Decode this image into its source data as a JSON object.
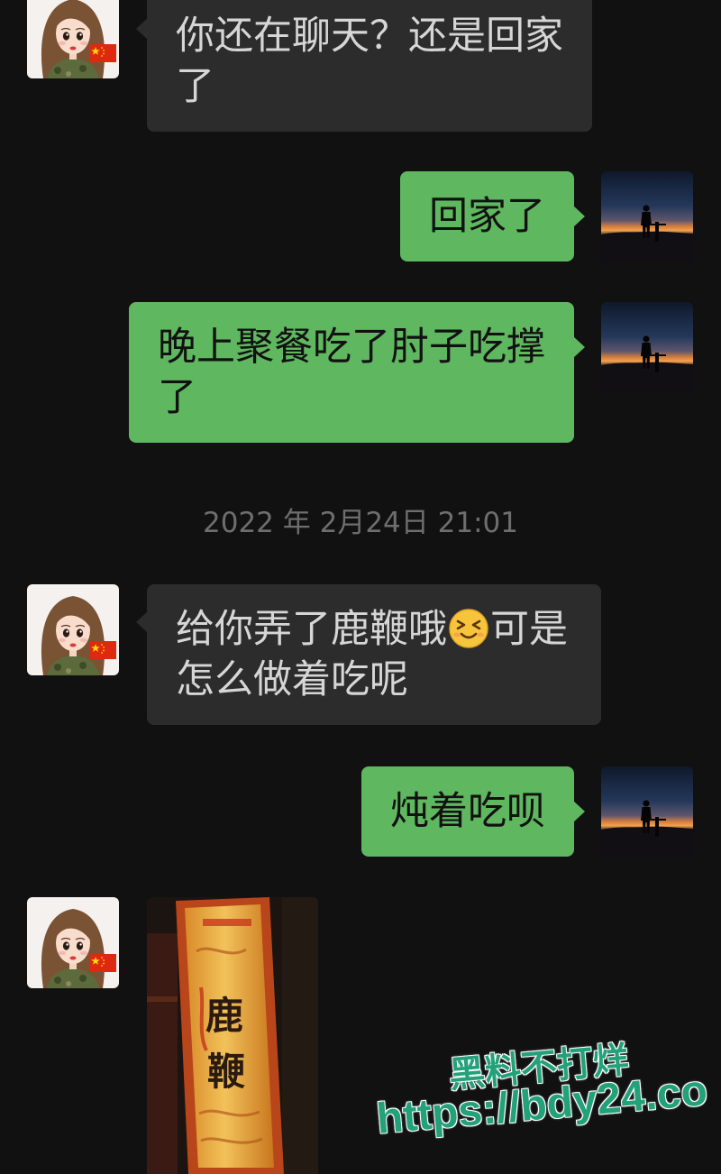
{
  "theme": {
    "background": "#111111",
    "incoming_bubble": "#2c2c2c",
    "incoming_text": "#d6d6d6",
    "outgoing_bubble": "#5fb760",
    "outgoing_text": "#111111",
    "timestamp_text": "#6e6e6e",
    "watermark_text": "#23a178"
  },
  "avatars": {
    "incoming": "girl-cartoon-avatar-icon",
    "outgoing": "sunset-silhouette-avatar-icon"
  },
  "messages": [
    {
      "text": "你还在聊天？还是回家了"
    },
    {
      "text": "回家了"
    },
    {
      "text": "晚上聚餐吃了肘子吃撑了"
    },
    {
      "text_before_emoji": "给你弄了鹿鞭哦",
      "emoji": "grinning-squinting-face-emoji",
      "text_after_emoji": "可是怎么做着吃呢"
    },
    {
      "text": "炖着吃呗"
    },
    {
      "image": "deer-product-package-photo",
      "label_chars": [
        "鹿",
        "鞭"
      ]
    }
  ],
  "timestamp": "2022 年 2月24日 21:01",
  "watermark": {
    "line1": "黑料不打烊",
    "line2": "https://bdy24.co"
  }
}
